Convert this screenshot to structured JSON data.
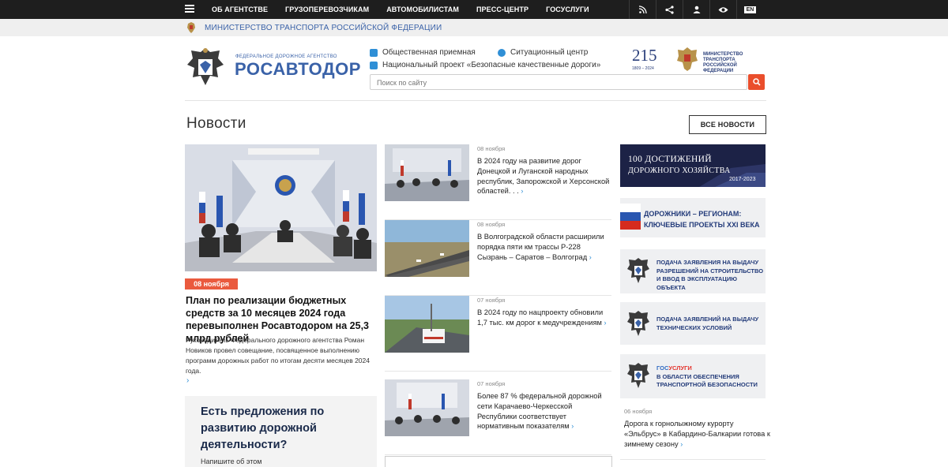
{
  "topnav": {
    "items": [
      "ОБ АГЕНТСТВЕ",
      "ГРУЗОПЕРЕВОЗЧИКАМ",
      "АВТОМОБИЛИСТАМ",
      "ПРЕСС-ЦЕНТР",
      "ГОСУСЛУГИ"
    ],
    "lang": "EN",
    "icons": [
      "menu-icon",
      "rss-icon",
      "share-icon",
      "user-icon",
      "eye-icon"
    ]
  },
  "ministry": {
    "text": "МИНИСТЕРСТВО ТРАНСПОРТА РОССИЙСКОЙ ФЕДЕРАЦИИ"
  },
  "logo": {
    "small": "ФЕДЕРАЛЬНОЕ ДОРОЖНОЕ АГЕНТСТВО",
    "big": "РОСАВТОДОР"
  },
  "header_links": {
    "reception": "Общественная приемная",
    "situation": "Ситуационный центр",
    "project": "Национальный проект «Безопасные качественные дороги»"
  },
  "search": {
    "placeholder": "Поиск по сайту"
  },
  "anniversary": {
    "number": "215",
    "years": "1809 – 2024",
    "ministry": "МИНИСТЕРСТВО ТРАНСПОРТА РОССИЙСКОЙ ФЕДЕРАЦИИ"
  },
  "news": {
    "title": "Новости",
    "all_label": "ВСЕ НОВОСТИ",
    "main": {
      "date": "08 ноября",
      "headline": "План по реализации бюджетных средств за 10 месяцев 2024 года перевыполнен Росавтодором на 25,3 млрд рублей",
      "desc": "Руководитель Федерального дорожного агентства Роман Новиков провел совещание, посвященное выполнению программ дорожных работ по итогам десяти месяцев 2024 года.",
      "arrow": "›"
    },
    "side": [
      {
        "date": "08 ноября",
        "text": "В 2024 году на развитие дорог Донецкой и Луганской народных республик, Запорожской и Херсонской областей. . ."
      },
      {
        "date": "08 ноября",
        "text": "В Волгоградской области расширили порядка пяти км трассы Р-228 Сызрань – Саратов – Волгоград"
      },
      {
        "date": "07 ноября",
        "text": "В 2024 году по нацпроекту обновили 1,7 тыс. км дорог к медучреждениям"
      },
      {
        "date": "07 ноября",
        "text": "Более 87 % федеральной дорожной сети Карачаево-Черкесской Республики соответствует нормативным показателям"
      }
    ]
  },
  "suggest": {
    "headline": "Есть предложения по развитию дорожной деятельности?",
    "sub": "Напишите об этом"
  },
  "banners": {
    "b1_line1": "100 ДОСТИЖЕНИЙ",
    "b1_line2": "ДОРОЖНОГО ХОЗЯЙСТВА",
    "b1_years": "2017-2023",
    "b2_line1": "ДОРОЖНИКИ – РЕГИОНАМ:",
    "b2_line2": "КЛЮЧЕВЫЕ ПРОЕКТЫ XXI ВЕКА",
    "b3": "ПОДАЧА ЗАЯВЛЕНИЯ НА ВЫДАЧУ РАЗРЕШЕНИЙ НА СТРОИТЕЛЬСТВО И ВВОД В ЭКСПЛУАТАЦИЮ ОБЪЕКТА",
    "b4": "ПОДАЧА ЗАЯВЛЕНИЙ НА ВЫДАЧУ ТЕХНИЧЕСКИХ УСЛОВИЙ",
    "b5_gos": "ГОС",
    "b5_uslugi": "УСЛУГИ",
    "b5_rest": "В ОБЛАСТИ ОБЕСПЕЧЕНИЯ ТРАНСПОРТНОЙ БЕЗОПАСНОСТИ"
  },
  "right_news": {
    "date": "06 ноября",
    "text": "Дорога к горнолыжному курорту «Эльбрус» в Кабардино-Балкарии готова к зимнему сезону"
  },
  "colors": {
    "topbar": "#1e1e1e",
    "accent": "#ea5a3e",
    "brand": "#3a62a8",
    "link": "#2f8fd6"
  }
}
